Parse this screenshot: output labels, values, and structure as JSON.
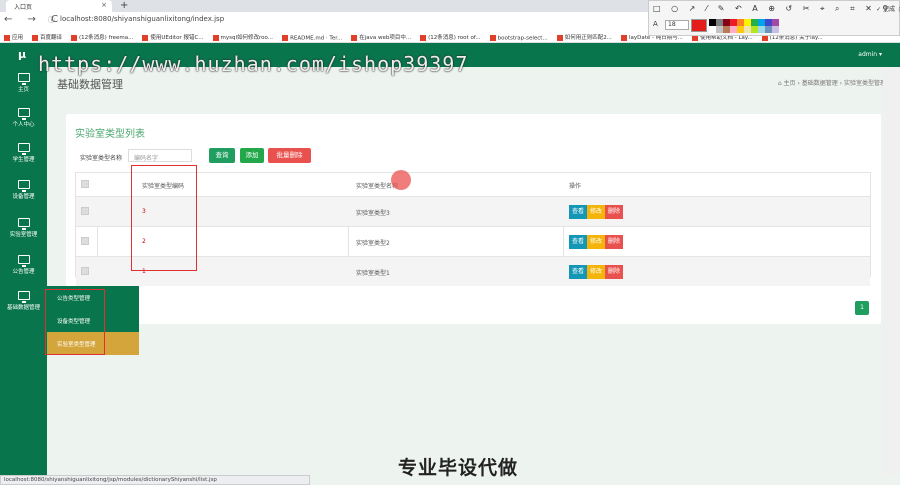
{
  "browser": {
    "tab_title": "入口页",
    "tab_close": "×",
    "new_tab": "+",
    "nav_icons": "← → C",
    "url": "localhost:8080/shiyanshiguanlixitong/index.jsp",
    "bookmarks": [
      "应用",
      "百度翻译",
      "(12条消息) freema...",
      "使用UEditor 报错C...",
      "mysql如何修改roo...",
      "README.md · Ter...",
      "在java web项目中...",
      "(12条消息) root of...",
      "bootstrap-select...",
      "如何用正则匹配2...",
      "layDate - 纯日期与...",
      "使用帮助文档 - Lay...",
      "(12条消息) 关于lay..."
    ],
    "status_url": "localhost:8080/shiyanshiguanlixitong/jsp/modules/dictionaryShiyanshi/list.jsp"
  },
  "screenshot_toolbar": {
    "tools": "□ ○ ↗ ⁄ ✎ ↶ A ⊕ ↺ ✂ ⌖ ⌕ ⌗ ✕ ⚲ ⎙ ✓",
    "done_label": "✓ 完成",
    "font_label": "A",
    "font_size": "18",
    "selected_color": "#e31c1c",
    "palette": [
      "#000000",
      "#7f7f7f",
      "#880015",
      "#ed1c24",
      "#ff7f27",
      "#fff200",
      "#22b14c",
      "#00a2e8",
      "#3f48cc",
      "#a349a4",
      "#ffffff",
      "#c3c3c3",
      "#b97a57",
      "#ffaec9",
      "#ffc90e",
      "#efe4b0",
      "#b5e61d",
      "#99d9ea",
      "#7092be",
      "#c8bfe7"
    ]
  },
  "app": {
    "logo": "μ",
    "admin": "admin ▾",
    "page_title": "基础数据管理",
    "breadcrumb": "⌂ 主页 › 基础数据管理 › 实验室类型管理",
    "sidebar": [
      {
        "label": "主页",
        "icon": "dashboard-icon"
      },
      {
        "label": "个人中心",
        "icon": "monitor-icon"
      },
      {
        "label": "学生管理",
        "icon": "monitor-icon"
      },
      {
        "label": "设备管理",
        "icon": "monitor-icon"
      },
      {
        "label": "实验室管理",
        "icon": "monitor-icon"
      },
      {
        "label": "公告管理",
        "icon": "monitor-icon"
      },
      {
        "label": "基础数据管理",
        "icon": "monitor-icon"
      }
    ],
    "submenu": [
      "公告类型管理",
      "设备类型管理",
      "实验室类型管理"
    ]
  },
  "main": {
    "list_title": "实验室类型列表",
    "search_label": "实验室类型名称",
    "search_placeholder": "编码名字",
    "search_button": "查询",
    "add_button": "添加",
    "batch_delete_button": "批量删除",
    "columns": [
      "实验室类型编码",
      "实验室类型名称",
      "操作"
    ],
    "rows": [
      {
        "code": "3",
        "name": "实验室类型3"
      },
      {
        "code": "2",
        "name": "实验室类型2"
      },
      {
        "code": "1",
        "name": "实验室类型1"
      }
    ],
    "row_actions": {
      "view": "查看",
      "edit": "修改",
      "delete": "删除"
    },
    "page": "1"
  },
  "overlay": {
    "watermark": "https://www.huzhan.com/ishop39397",
    "bottom_text": "专业毕设代做"
  }
}
